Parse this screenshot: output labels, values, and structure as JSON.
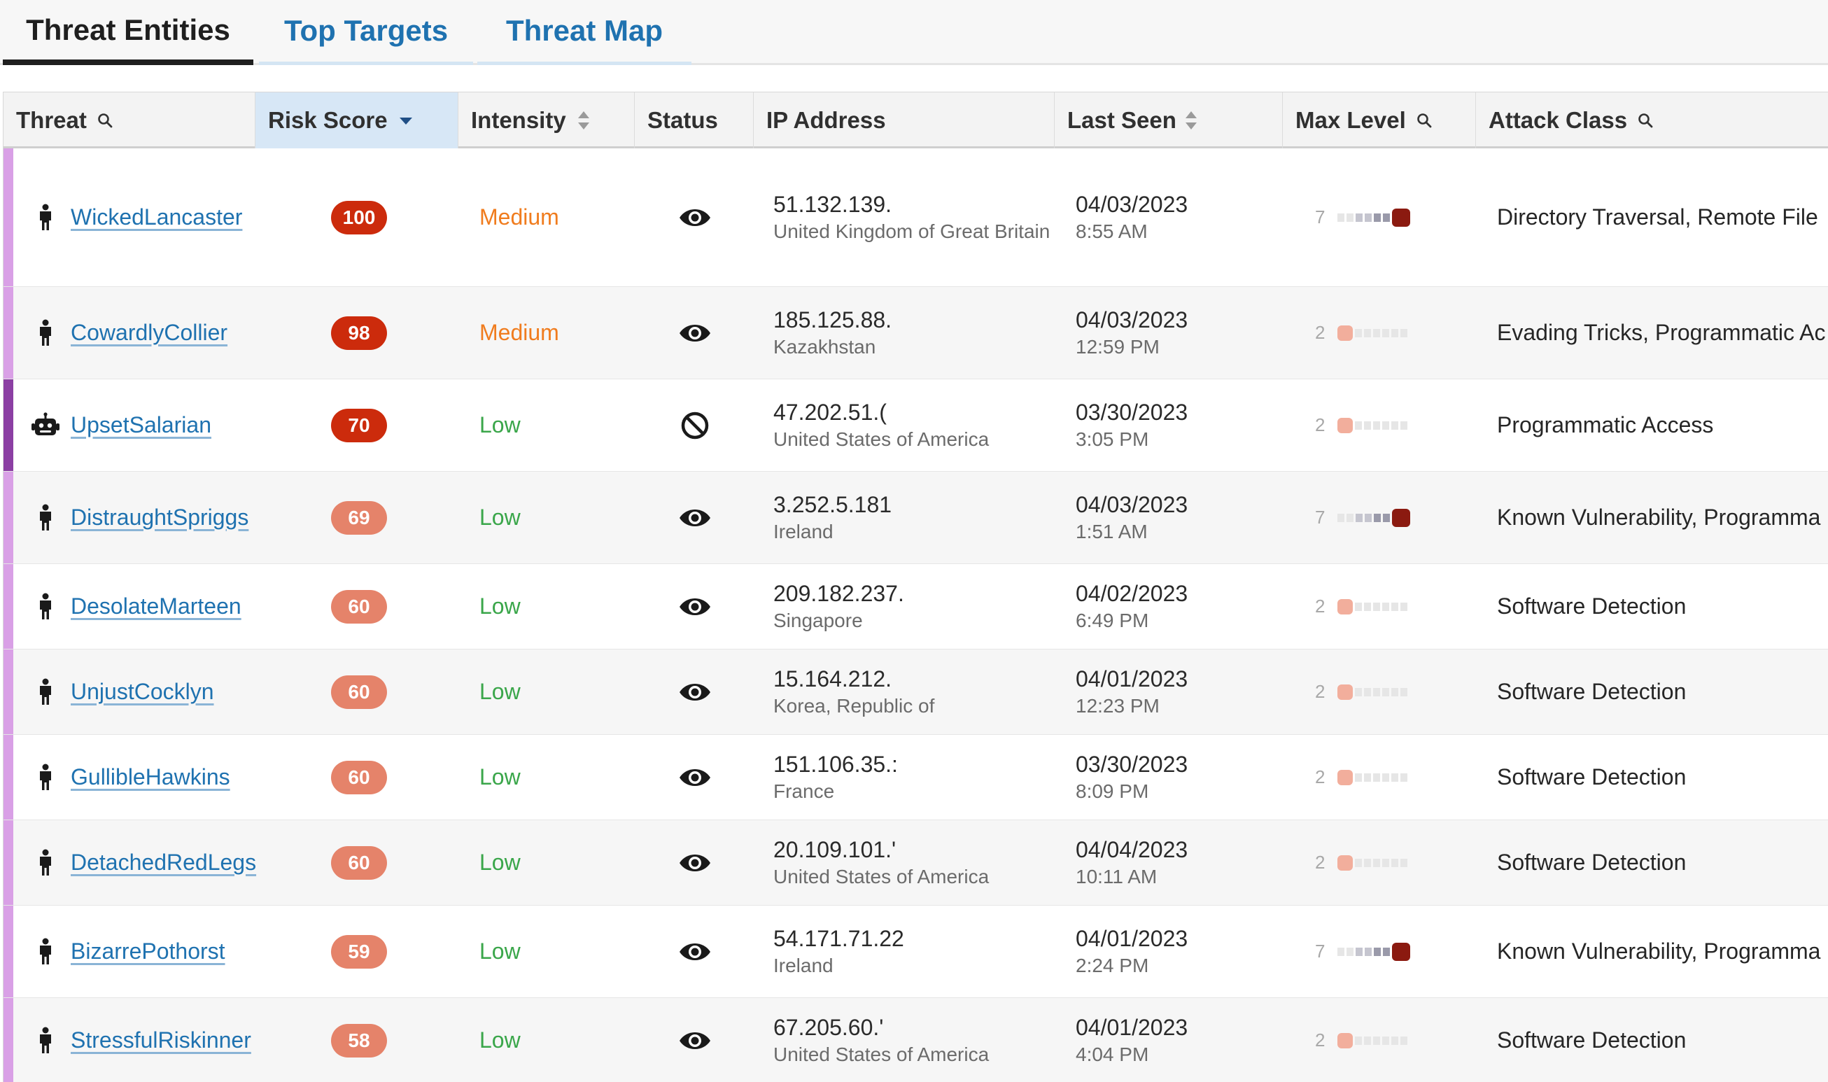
{
  "tabs": [
    {
      "label": "Threat Entities",
      "active": true
    },
    {
      "label": "Top Targets",
      "active": false
    },
    {
      "label": "Threat Map",
      "active": false
    }
  ],
  "columns": {
    "threat": "Threat",
    "risk": "Risk Score",
    "intensity": "Intensity",
    "status": "Status",
    "ip": "IP Address",
    "last_seen": "Last Seen",
    "max_level": "Max Level",
    "attack_class": "Attack Class"
  },
  "colors": {
    "stripe_human": "#d9a0e6",
    "stripe_bot": "#8b3fa3",
    "risk_high": "#cc2b0c",
    "risk_mid": "#e5836a",
    "medium": "#f07c1e",
    "low": "#3aa64a",
    "level_high": "#8b1a10",
    "level_low": "#f2ae9c"
  },
  "rows": [
    {
      "name": "WickedLancaster",
      "type": "human-icon",
      "risk": "100",
      "intensity": "Medium",
      "status": "eye-icon",
      "ip": "51.132.139.",
      "country": "United Kingdom of Great Britain",
      "date": "04/03/2023",
      "time": "8:55 AM",
      "level": "7",
      "attack": "Directory Traversal, Remote File"
    },
    {
      "name": "CowardlyCollier",
      "type": "human-icon",
      "risk": "98",
      "intensity": "Medium",
      "status": "eye-icon",
      "ip": "185.125.88.",
      "country": "Kazakhstan",
      "date": "04/03/2023",
      "time": "12:59 PM",
      "level": "2",
      "attack": "Evading Tricks, Programmatic Ac"
    },
    {
      "name": "UpsetSalarian",
      "type": "bot-icon",
      "risk": "70",
      "intensity": "Low",
      "status": "blocked-icon",
      "ip": "47.202.51.(",
      "country": "United States of America",
      "date": "03/30/2023",
      "time": "3:05 PM",
      "level": "2",
      "attack": "Programmatic Access"
    },
    {
      "name": "DistraughtSpriggs",
      "type": "human-icon",
      "risk": "69",
      "intensity": "Low",
      "status": "eye-icon",
      "ip": "3.252.5.181",
      "country": "Ireland",
      "date": "04/03/2023",
      "time": "1:51 AM",
      "level": "7",
      "attack": "Known Vulnerability, Programma"
    },
    {
      "name": "DesolateMarteen",
      "type": "human-icon",
      "risk": "60",
      "intensity": "Low",
      "status": "eye-icon",
      "ip": "209.182.237.",
      "country": "Singapore",
      "date": "04/02/2023",
      "time": "6:49 PM",
      "level": "2",
      "attack": "Software Detection"
    },
    {
      "name": "UnjustCocklyn",
      "type": "human-icon",
      "risk": "60",
      "intensity": "Low",
      "status": "eye-icon",
      "ip": "15.164.212.",
      "country": "Korea, Republic of",
      "date": "04/01/2023",
      "time": "12:23 PM",
      "level": "2",
      "attack": "Software Detection"
    },
    {
      "name": "GullibleHawkins",
      "type": "human-icon",
      "risk": "60",
      "intensity": "Low",
      "status": "eye-icon",
      "ip": "151.106.35.:",
      "country": "France",
      "date": "03/30/2023",
      "time": "8:09 PM",
      "level": "2",
      "attack": "Software Detection"
    },
    {
      "name": "DetachedRedLegs",
      "type": "human-icon",
      "risk": "60",
      "intensity": "Low",
      "status": "eye-icon",
      "ip": "20.109.101.'",
      "country": "United States of America",
      "date": "04/04/2023",
      "time": "10:11 AM",
      "level": "2",
      "attack": "Software Detection"
    },
    {
      "name": "BizarrePothorst",
      "type": "human-icon",
      "risk": "59",
      "intensity": "Low",
      "status": "eye-icon",
      "ip": "54.171.71.22",
      "country": "Ireland",
      "date": "04/01/2023",
      "time": "2:24 PM",
      "level": "7",
      "attack": "Known Vulnerability, Programma"
    },
    {
      "name": "StressfulRiskinner",
      "type": "human-icon",
      "risk": "58",
      "intensity": "Low",
      "status": "eye-icon",
      "ip": "67.205.60.'",
      "country": "United States of America",
      "date": "04/01/2023",
      "time": "4:04 PM",
      "level": "2",
      "attack": "Software Detection"
    }
  ]
}
